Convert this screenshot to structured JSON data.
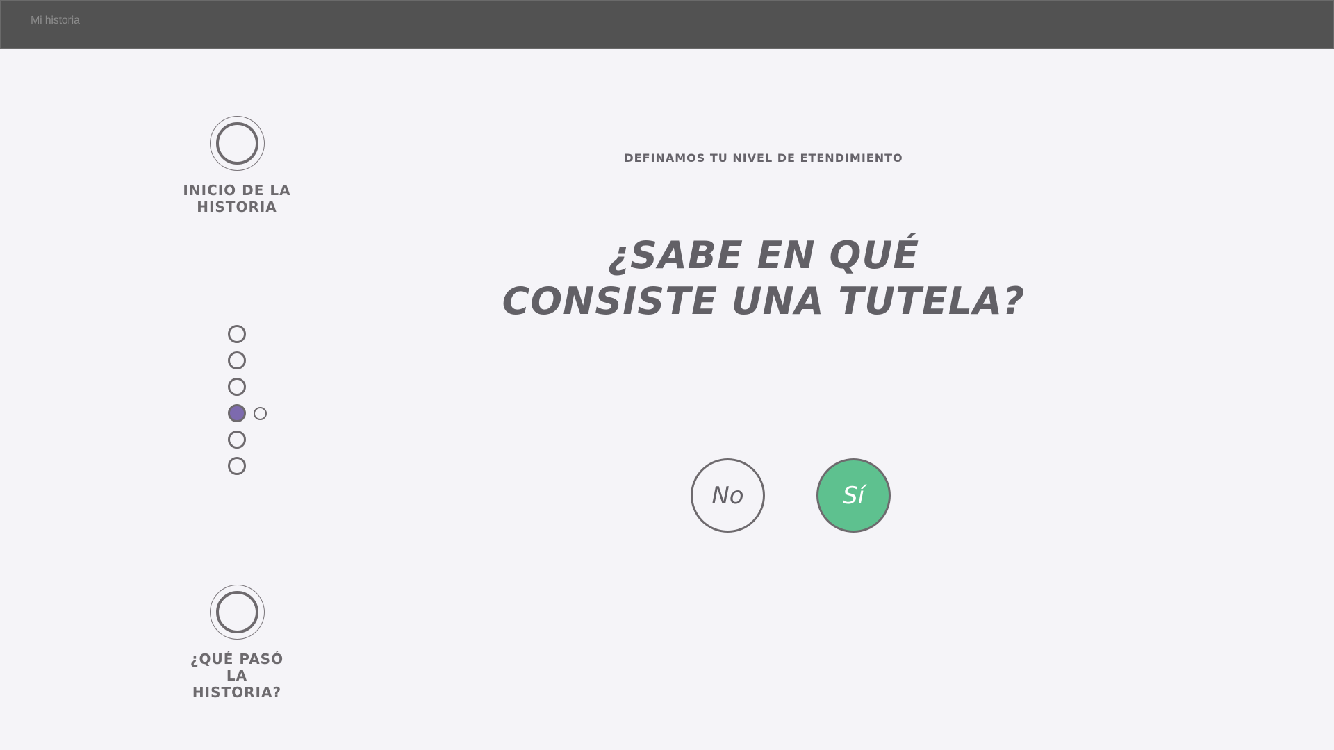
{
  "app": {
    "title": "Mi historia"
  },
  "sidebar": {
    "start_label": "INICIO DE LA HISTORIA",
    "end_label": "¿QUÉ PASÓ LA HISTORIA?",
    "steps_total": 6,
    "active_step": 4,
    "substep_visible": true
  },
  "main": {
    "eyebrow": "DEFINAMOS TU NIVEL DE ETENDIMIENTO",
    "question_line1": "¿Sabe en qué",
    "question_line2": "consiste una tutela?",
    "answers": {
      "no_label": "No",
      "yes_label": "Sí"
    }
  },
  "colors": {
    "topbar": "#525252",
    "background": "#f5f4f8",
    "active_step": "#7d6aae",
    "yes_button": "#5ec18f",
    "text": "#66636a"
  }
}
